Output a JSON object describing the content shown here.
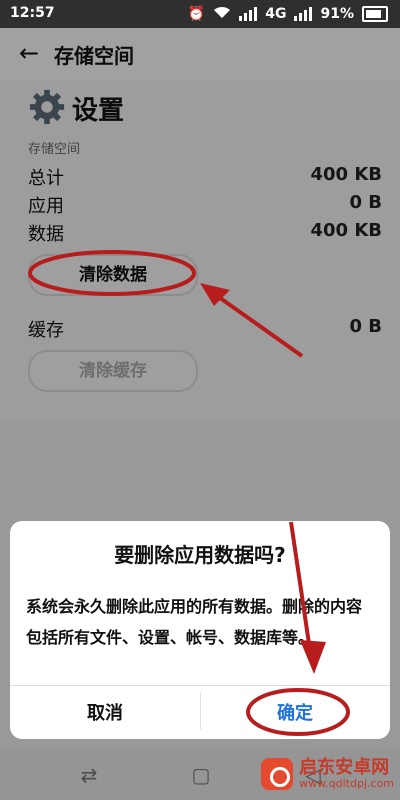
{
  "status_bar": {
    "time": "12:57",
    "network": "4G",
    "battery": "91%"
  },
  "header": {
    "title": "存储空间",
    "back_icon": "arrow-left-icon"
  },
  "app": {
    "name": "设置",
    "icon": "gear-icon"
  },
  "storage": {
    "section_label": "存储空间",
    "rows": [
      {
        "label": "总计",
        "value": "400 KB"
      },
      {
        "label": "应用",
        "value": "0 B"
      },
      {
        "label": "数据",
        "value": "400 KB"
      }
    ],
    "clear_data_label": "清除数据",
    "cache_label": "缓存",
    "cache_value": "0 B",
    "clear_cache_label": "清除缓存"
  },
  "dialog": {
    "title": "要删除应用数据吗?",
    "body": "系统会永久删除此应用的所有数据。删除的内容包括所有文件、设置、帐号、数据库等。",
    "cancel_label": "取消",
    "ok_label": "确定"
  },
  "colors": {
    "accent": "#1e73d8",
    "annotation_red": "#b81d1d",
    "status_bar": "#2f2f2f"
  },
  "watermark": {
    "title": "启东安卓网",
    "url": "www.qdltdpj.com"
  }
}
